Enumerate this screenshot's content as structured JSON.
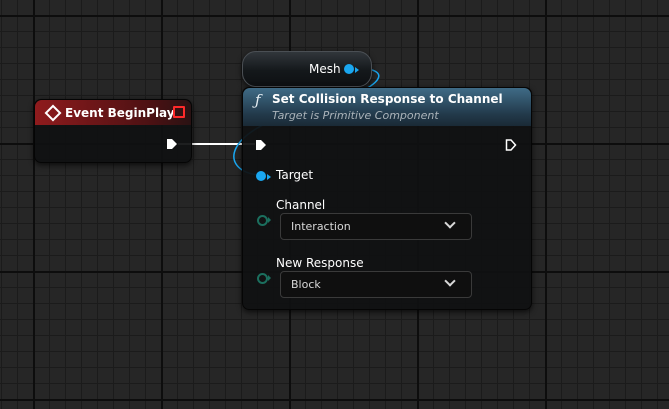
{
  "mesh_node": {
    "label": "Mesh"
  },
  "event_node": {
    "title": "Event BeginPlay"
  },
  "function_node": {
    "title": "Set Collision Response to Channel",
    "subtitle": "Target is Primitive Component",
    "target_label": "Target",
    "channel_label": "Channel",
    "channel_value": "Interaction",
    "response_label": "New Response",
    "response_value": "Block"
  },
  "colors": {
    "exec_wire": "#ffffff",
    "object_pin": "#1aa7f0",
    "enum_pin": "#1b6f5e",
    "event_header": "#8f1b1d",
    "function_header": "#3f6b86"
  },
  "icons": {
    "event": "diamond-icon",
    "delegate": "square-delegate-icon",
    "function": "function-f-icon",
    "dropdown": "chevron-down-icon"
  }
}
